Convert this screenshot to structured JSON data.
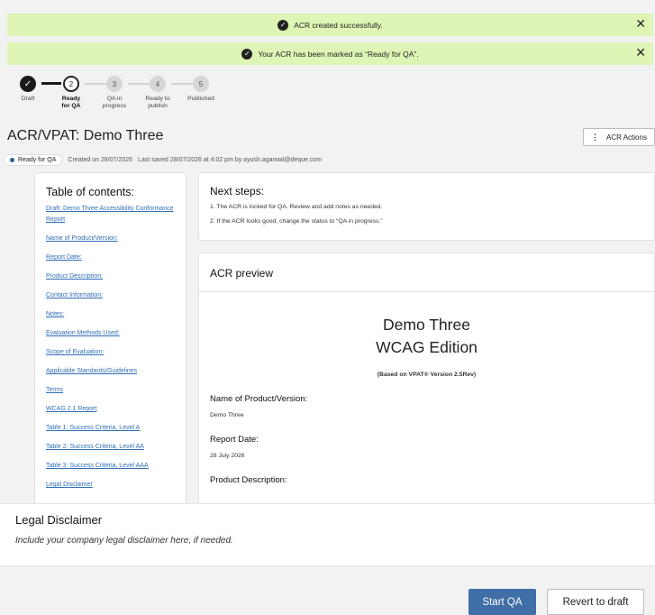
{
  "alerts": [
    {
      "text": "ACR created successfully."
    },
    {
      "text": "Your ACR has been marked as “Ready for QA”."
    }
  ],
  "stepper": {
    "steps": [
      {
        "number": "",
        "label": "Draft",
        "state": "done"
      },
      {
        "number": "2",
        "label": "Ready for QA",
        "state": "current"
      },
      {
        "number": "3",
        "label": "QA in progress",
        "state": "todo"
      },
      {
        "number": "4",
        "label": "Ready to publish",
        "state": "todo"
      },
      {
        "number": "5",
        "label": "Published",
        "state": "todo"
      }
    ]
  },
  "page": {
    "title": "ACR/VPAT: Demo Three",
    "actions_label": "ACR Actions",
    "status_badge": "Ready for QA",
    "created": "Created on 28/07/2026",
    "saved": "Last saved 28/07/2026 at 4:02 pm by ayush.agarwal@deque.com"
  },
  "toc": {
    "heading": "Table of contents:",
    "items": [
      "Draft: Demo Three Accessibility Conformance Report",
      "Name of Product/Version:",
      "Report Date:",
      "Product Description:",
      "Contact Information:",
      "Notes:",
      "Evaluation Methods Used:",
      "Scope of Evaluation:",
      "Applicable Standards/Guidelines",
      "Terms",
      "WCAG 2.1 Report",
      "Table 1: Success Criteria, Level A",
      "Table 2: Success Criteria, Level AA",
      "Table 3: Success Criteria, Level AAA",
      "Legal Disclaimer"
    ]
  },
  "next_steps": {
    "heading": "Next steps:",
    "lines": [
      "1. The ACR is locked for QA. Review and add notes as needed.",
      "2. If the ACR looks good, change the status to “QA in progress.”"
    ]
  },
  "preview": {
    "heading": "ACR preview",
    "doc_title_1": "Demo Three",
    "doc_title_2": "WCAG Edition",
    "based_on": "(Based on VPAT® Version 2.5Rev)",
    "sections": [
      {
        "label": "Name of Product/Version:",
        "value": "Demo Three"
      },
      {
        "label": "Report Date:",
        "value": "28 July 2026"
      },
      {
        "label": "Product Description:",
        "value": ""
      }
    ]
  },
  "legal": {
    "heading": "Legal Disclaimer",
    "text": "Include your company legal disclaimer here, if needed."
  },
  "buttons": {
    "start_qa": "Start QA",
    "revert": "Revert to draft"
  },
  "colors": {
    "alert_bg": "#dff5b5",
    "primary": "#3f6fa6",
    "link": "#2f6fb5"
  }
}
